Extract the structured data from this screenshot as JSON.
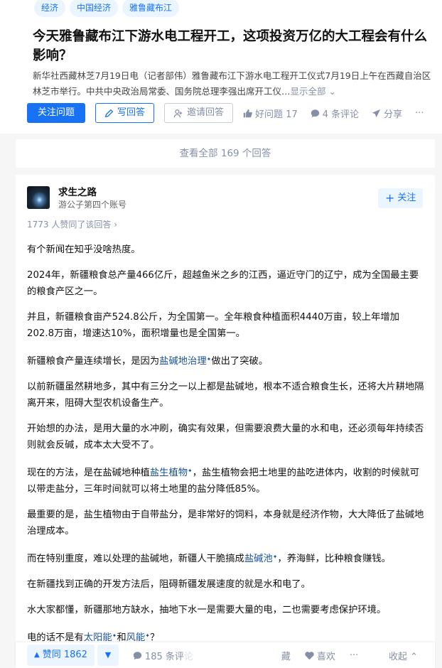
{
  "tags": [
    "经济",
    "中国经济",
    "雅鲁藏布江"
  ],
  "question": {
    "title": "今天雅鲁藏布江下游水电工程开工，这项投资万亿的大工程会有什么影响？",
    "desc": "新华社西藏林芝7月19日电（记者部伟）雅鲁藏布江下游水电工程开工仪式7月19日上午在西藏自治区林芝市举行。中共中央政治局常委、国务院总理李强出席开工仪…",
    "more": "显示全部",
    "follow_label": "关注问题",
    "write_label": "写回答",
    "invite_label": "邀请回答",
    "good_label": "好问题 17",
    "comment_label": "4 条评论",
    "share_label": "分享",
    "more_dots": "···"
  },
  "view_all": "查看全部 169 个回答",
  "answer": {
    "author": "求生之路",
    "bio": "游公子第四个账号",
    "follow_label": "关注",
    "voters": "1773 人赞同了该回答",
    "paragraphs": [
      "有个新闻在知乎没啥热度。",
      "2024年，新疆粮食总产量466亿斤，超越鱼米之乡的江西，逼近守门的辽宁，成为全国最主要的粮食产区之一。",
      "并且，新疆粮食亩产524.8公斤，为全国第一。全年粮食种植面积4440万亩，较上年增加202.8万亩，增速达10%，面积增量也是全国第一。"
    ],
    "p4_a": "新疆粮食产量连续增长，是因为",
    "p4_kw": "盐碱地治理",
    "p4_b": "做出了突破。",
    "p5": "以前新疆虽然耕地多，其中有三分之一以上都是盐碱地，根本不适合粮食生长，还将大片耕地隔离开来，阻碍大型农机设备生产。",
    "p6": "开始想的办法，是用大量的水冲刷，确实有效果，但需要浪费大量的水和电，还必须每年持续否则就会反碱，成本太大受不了。",
    "p7_a": "现在的方法，是在盐碱地种植",
    "p7_kw": "盐生植物",
    "p7_b": "，盐生植物会把土地里的盐吃进体内，收割的时候就可以带走盐分，三年时间就可以将土地里的盐分降低85%。",
    "p8": "最重要的是，盐生植物由于自带盐分，是非常好的饲料，本身就是经济作物，大大降低了盐碱地治理成本。",
    "p9_a": "而在特别重度，难以处理的盐碱地，新疆人干脆搞成",
    "p9_kw": "盐碱池",
    "p9_b": "，养海鲜，比种粮食赚钱。",
    "p10": "在新疆找到正确的开发方法后，阻碍新疆发展速度的就是水和电了。",
    "p11": "水大家都懂，新疆那地方缺水，抽地下水一是需要大量的电，二也需要考虑保护环境。",
    "p12_a": "电的话不是有",
    "p12_kw1": "太阳能",
    "p12_mid": "和",
    "p12_kw2": "风能",
    "p12_b": "？",
    "kw_mark": "✦"
  },
  "bottombar": {
    "vote_up": "赞同 1862",
    "comments": "185 条评论",
    "share_hidden": "藏",
    "like": "喜欢",
    "collapse": "收起"
  },
  "colors": {
    "brand": "#1772f6",
    "brand_light": "#ebf5ff",
    "gray": "#8590a6"
  }
}
